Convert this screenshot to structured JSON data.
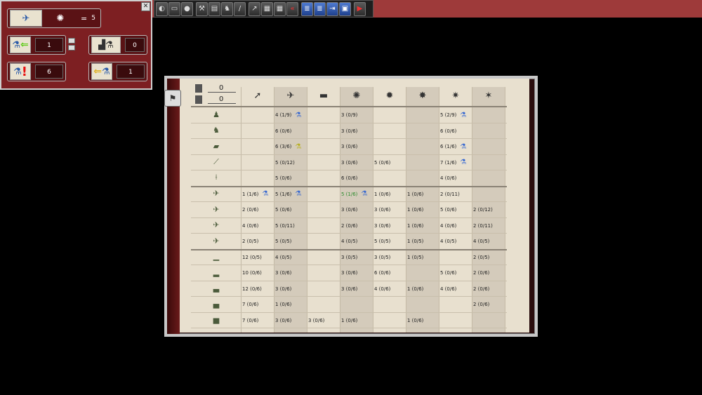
{
  "toolbar": {
    "buttons": [
      {
        "name": "map-icon",
        "glyph": "◐"
      },
      {
        "name": "document-icon",
        "glyph": "▭"
      },
      {
        "name": "globe-icon",
        "glyph": "●"
      },
      {
        "name": "production-icon",
        "glyph": "⚒"
      },
      {
        "name": "technology-icon",
        "glyph": "▤"
      },
      {
        "name": "troops-icon",
        "glyph": "♞"
      },
      {
        "name": "pen-icon",
        "glyph": "/"
      },
      {
        "name": "missile-icon",
        "glyph": "↗"
      },
      {
        "name": "ledger-icon",
        "glyph": "▦"
      },
      {
        "name": "grid-icon",
        "glyph": "▦"
      },
      {
        "name": "rewind-icon",
        "glyph": "«"
      },
      {
        "name": "list-icon",
        "glyph": "≣"
      },
      {
        "name": "list-add-icon",
        "glyph": "≣"
      },
      {
        "name": "export-icon",
        "glyph": "⇥"
      },
      {
        "name": "save-icon",
        "glyph": "▣"
      },
      {
        "name": "play-icon",
        "glyph": "▶"
      }
    ]
  },
  "info_panel": {
    "top_value": "5",
    "equals": "=",
    "research_in_value": "1",
    "factories_value": "0",
    "alert_value": "6",
    "research_out_value": "1"
  },
  "book": {
    "resources": [
      "0",
      "0"
    ],
    "rows": [
      {
        "unit": "infantry-icon",
        "cells": [
          "",
          "4 (1/9)",
          "",
          "3 (0/9)",
          "",
          "",
          "5 (2/9)",
          ""
        ],
        "flask": [
          1,
          6
        ]
      },
      {
        "unit": "cavalry-icon",
        "cells": [
          "",
          "6 (0/6)",
          "",
          "3 (0/6)",
          "",
          "",
          "6 (0/6)",
          ""
        ],
        "flask": []
      },
      {
        "unit": "tank-icon",
        "cells": [
          "",
          "6 (3/6)",
          "",
          "3 (0/6)",
          "",
          "",
          "6 (1/6)",
          ""
        ],
        "flask": [
          1,
          6
        ]
      },
      {
        "unit": "artillery-icon",
        "cells": [
          "",
          "5 (0/12)",
          "",
          "3 (0/6)",
          "5 (0/6)",
          "",
          "7 (1/6)",
          ""
        ],
        "flask": [
          6
        ]
      },
      {
        "unit": "aa-gun-icon",
        "cells": [
          "",
          "5 (0/6)",
          "",
          "6 (0/6)",
          "",
          "",
          "4 (0/6)",
          ""
        ],
        "flask": []
      },
      {
        "unit": "fighter-icon",
        "cells": [
          "1 (1/6)",
          "5 (1/6)",
          "",
          "5 (1/6)",
          "1 (0/6)",
          "1 (0/6)",
          "2 (0/11)",
          ""
        ],
        "flask": [
          0,
          1,
          3
        ]
      },
      {
        "unit": "tac-bomber-icon",
        "cells": [
          "2 (0/6)",
          "5 (0/6)",
          "",
          "3 (0/6)",
          "3 (0/6)",
          "1 (0/6)",
          "5 (0/6)",
          "2 (0/12)"
        ],
        "flask": []
      },
      {
        "unit": "bomber-icon",
        "cells": [
          "4 (0/6)",
          "5 (0/11)",
          "",
          "2 (0/6)",
          "3 (0/6)",
          "1 (0/6)",
          "4 (0/6)",
          "2 (0/11)"
        ],
        "flask": []
      },
      {
        "unit": "heavy-bomber-icon",
        "cells": [
          "2 (0/5)",
          "5 (0/5)",
          "",
          "4 (0/5)",
          "5 (0/5)",
          "1 (0/5)",
          "4 (0/5)",
          "4 (0/5)"
        ],
        "flask": []
      },
      {
        "unit": "submarine-icon",
        "cells": [
          "12 (0/5)",
          "4 (0/5)",
          "",
          "3 (0/5)",
          "3 (0/5)",
          "1 (0/5)",
          "",
          "2 (0/5)"
        ],
        "flask": []
      },
      {
        "unit": "destroyer-icon",
        "cells": [
          "10 (0/6)",
          "3 (0/6)",
          "",
          "3 (0/6)",
          "6 (0/6)",
          "",
          "5 (0/6)",
          "2 (0/6)"
        ],
        "flask": []
      },
      {
        "unit": "cruiser-icon",
        "cells": [
          "12 (0/6)",
          "3 (0/6)",
          "",
          "3 (0/6)",
          "4 (0/6)",
          "1 (0/6)",
          "4 (0/6)",
          "2 (0/6)"
        ],
        "flask": []
      },
      {
        "unit": "carrier-icon",
        "cells": [
          "7 (0/6)",
          "1 (0/6)",
          "",
          "",
          "",
          "",
          "",
          "2 (0/6)"
        ],
        "flask": []
      },
      {
        "unit": "battleship-icon",
        "cells": [
          "7 (0/6)",
          "3 (0/6)",
          "3 (0/6)",
          "1 (0/6)",
          "",
          "1 (0/6)",
          "",
          ""
        ],
        "flask": []
      }
    ],
    "highlight": {
      "row": 5,
      "col": 3
    }
  }
}
